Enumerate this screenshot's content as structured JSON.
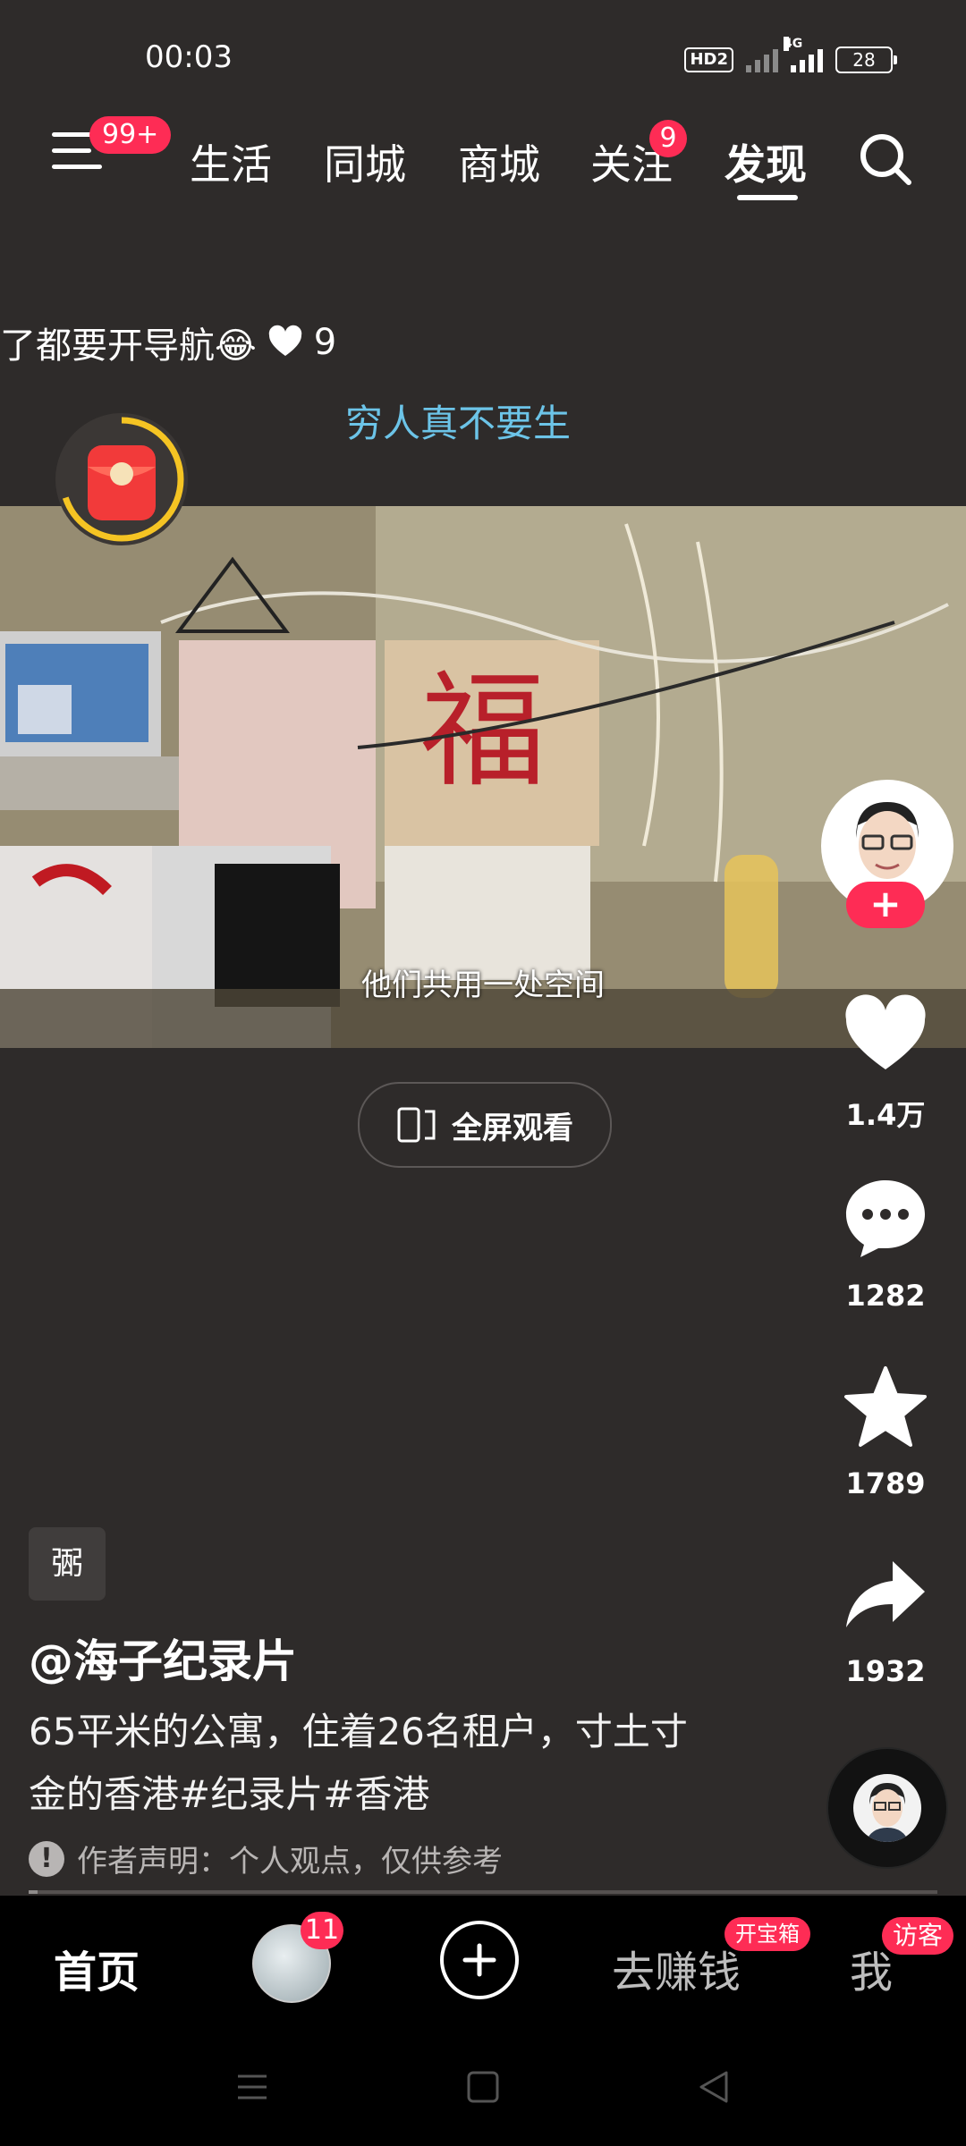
{
  "status_bar": {
    "time": "00:03",
    "hd": "HD2",
    "network": "4G",
    "battery": "28"
  },
  "top_nav": {
    "menu_badge": "99+",
    "tabs": [
      {
        "label": "生活",
        "active": false
      },
      {
        "label": "同城",
        "active": false
      },
      {
        "label": "商城",
        "active": false
      },
      {
        "label": "关注",
        "active": false,
        "badge": "9"
      },
      {
        "label": "发现",
        "active": true
      }
    ]
  },
  "comment_preview": {
    "text": "了都要开导航😂",
    "likes": "9"
  },
  "hashtag_title": "穷人真不要生",
  "video": {
    "subtitle": "他们共用一处空间"
  },
  "fullscreen_label": "全屏观看",
  "right_rail": {
    "follow_plus": "+",
    "likes": "1.4万",
    "comments": "1282",
    "favorites": "1789",
    "shares": "1932"
  },
  "post": {
    "tag": "弻",
    "author": "@海子纪录片",
    "description": "65平米的公寓，住着26名租户，寸土寸金的香港#纪录片#香港",
    "disclaimer": "作者声明：个人观点，仅供参考",
    "progress": 0.01
  },
  "bottom_nav": {
    "home": "首页",
    "friends_badge": "11",
    "earn": "去赚钱",
    "earn_badge": "开宝箱",
    "me": "我",
    "me_badge": "访客"
  },
  "colors": {
    "accent": "#fe2c55",
    "hashtag": "#6cc4e8",
    "background": "#2e2b2a"
  }
}
